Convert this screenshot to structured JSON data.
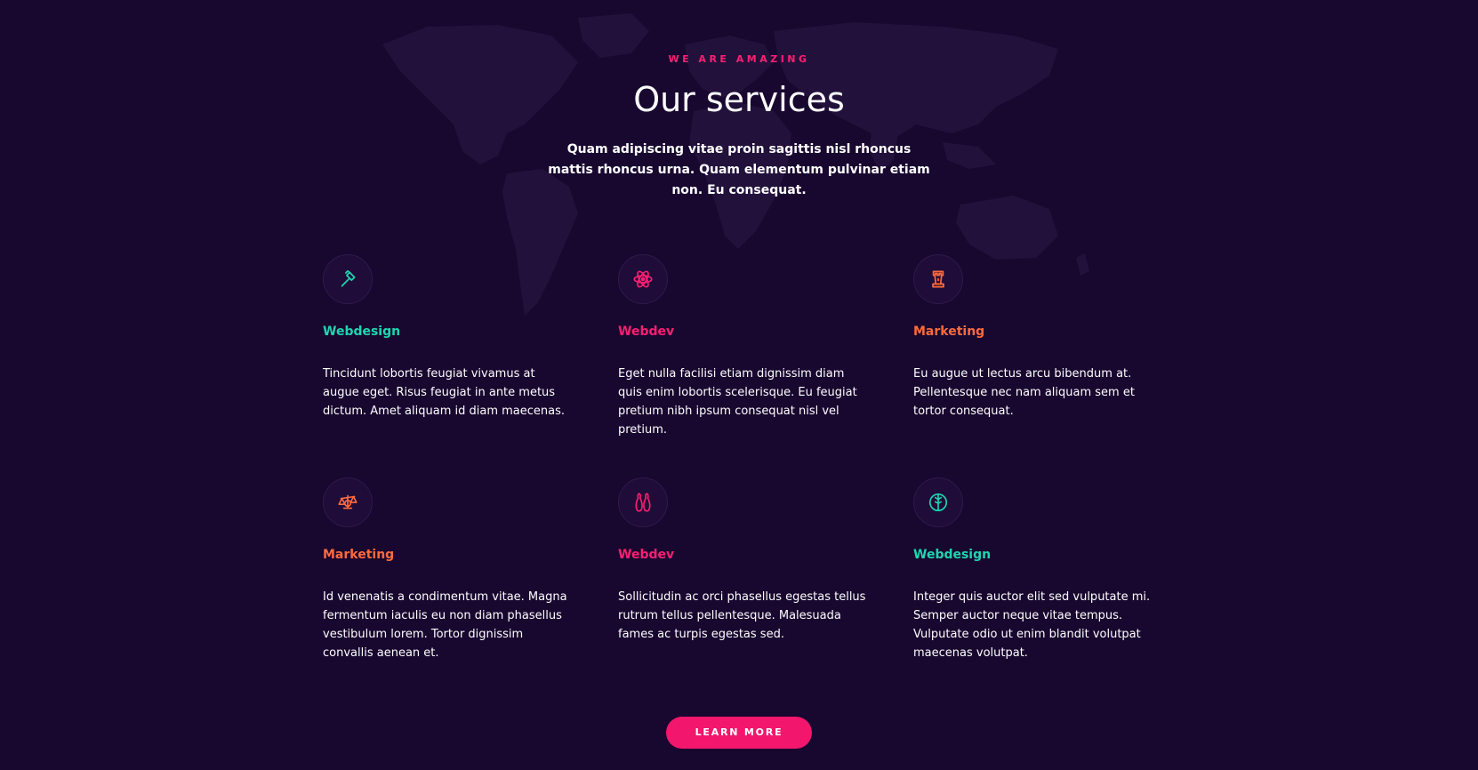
{
  "section": {
    "eyebrow": "WE ARE AMAZING",
    "title": "Our services",
    "subtitle": "Quam adipiscing vitae proin sagittis nisl rhoncus mattis rhoncus urna. Quam elementum pulvinar etiam non. Eu consequat."
  },
  "services": [
    {
      "icon": "hammer-icon",
      "title": "Webdesign",
      "color": "#1fd6b0",
      "text": "Tincidunt lobortis feugiat vivamus at augue eget. Risus feugiat in ante metus dictum. Amet aliquam id diam maecenas."
    },
    {
      "icon": "atom-icon",
      "title": "Webdev",
      "color": "#ff1f72",
      "text": "Eget nulla facilisi etiam dignissim diam quis enim lobortis scelerisque. Eu feugiat pretium nibh ipsum consequat nisl vel pretium."
    },
    {
      "icon": "chess-rook-icon",
      "title": "Marketing",
      "color": "#ff6a3d",
      "text": "Eu augue ut lectus arcu bibendum at. Pellentesque nec nam aliquam sem et tortor consequat."
    },
    {
      "icon": "balance-scale-icon",
      "title": "Marketing",
      "color": "#ff6a3d",
      "text": "Id venenatis a condimentum vitae. Magna fermentum iaculis eu non diam phasellus vestibulum lorem. Tortor dignissim convallis aenean et."
    },
    {
      "icon": "bowling-pins-icon",
      "title": "Webdev",
      "color": "#ff1f72",
      "text": "Sollicitudin ac orci phasellus egestas tellus rutrum tellus pellentesque. Malesuada fames ac turpis egestas sed."
    },
    {
      "icon": "brain-icon",
      "title": "Webdesign",
      "color": "#1fd6b0",
      "text": "Integer quis auctor elit sed vulputate mi. Semper auctor neque vitae tempus. Vulputate odio ut enim blandit volutpat maecenas volutpat."
    }
  ],
  "cta": {
    "label": "LEARN MORE"
  },
  "colors": {
    "background": "#18072f",
    "accent": "#f2166c",
    "teal": "#1fd6b0",
    "pink": "#ff1f72",
    "orange": "#ff6a3d"
  }
}
